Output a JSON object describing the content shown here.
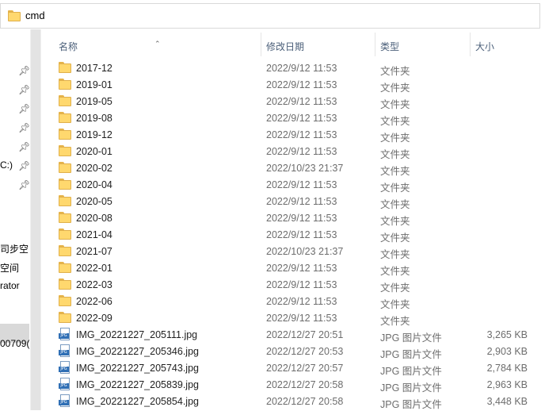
{
  "address": {
    "path": "cmd"
  },
  "nav": {
    "pins": [
      "pin-icon",
      "pin-icon",
      "pin-icon",
      "pin-icon",
      "pin-icon",
      "pin-icon",
      "pin-icon"
    ],
    "labels": [
      "C:)",
      "司步空",
      "空间",
      "rator",
      "00709("
    ]
  },
  "columns": {
    "name": "名称",
    "date": "修改日期",
    "type": "类型",
    "size": "大小"
  },
  "files": [
    {
      "name": "2017-12",
      "date": "2022/9/12 11:53",
      "type": "文件夹",
      "size": "",
      "icon": "folder-icon"
    },
    {
      "name": "2019-01",
      "date": "2022/9/12 11:53",
      "type": "文件夹",
      "size": "",
      "icon": "folder-icon"
    },
    {
      "name": "2019-05",
      "date": "2022/9/12 11:53",
      "type": "文件夹",
      "size": "",
      "icon": "folder-icon"
    },
    {
      "name": "2019-08",
      "date": "2022/9/12 11:53",
      "type": "文件夹",
      "size": "",
      "icon": "folder-icon"
    },
    {
      "name": "2019-12",
      "date": "2022/9/12 11:53",
      "type": "文件夹",
      "size": "",
      "icon": "folder-icon"
    },
    {
      "name": "2020-01",
      "date": "2022/9/12 11:53",
      "type": "文件夹",
      "size": "",
      "icon": "folder-icon"
    },
    {
      "name": "2020-02",
      "date": "2022/10/23 21:37",
      "type": "文件夹",
      "size": "",
      "icon": "folder-icon"
    },
    {
      "name": "2020-04",
      "date": "2022/9/12 11:53",
      "type": "文件夹",
      "size": "",
      "icon": "folder-icon"
    },
    {
      "name": "2020-05",
      "date": "2022/9/12 11:53",
      "type": "文件夹",
      "size": "",
      "icon": "folder-icon"
    },
    {
      "name": "2020-08",
      "date": "2022/9/12 11:53",
      "type": "文件夹",
      "size": "",
      "icon": "folder-icon"
    },
    {
      "name": "2021-04",
      "date": "2022/9/12 11:53",
      "type": "文件夹",
      "size": "",
      "icon": "folder-icon"
    },
    {
      "name": "2021-07",
      "date": "2022/10/23 21:37",
      "type": "文件夹",
      "size": "",
      "icon": "folder-icon"
    },
    {
      "name": "2022-01",
      "date": "2022/9/12 11:53",
      "type": "文件夹",
      "size": "",
      "icon": "folder-icon"
    },
    {
      "name": "2022-03",
      "date": "2022/9/12 11:53",
      "type": "文件夹",
      "size": "",
      "icon": "folder-icon"
    },
    {
      "name": "2022-06",
      "date": "2022/9/12 11:53",
      "type": "文件夹",
      "size": "",
      "icon": "folder-icon"
    },
    {
      "name": "2022-09",
      "date": "2022/9/12 11:53",
      "type": "文件夹",
      "size": "",
      "icon": "folder-icon"
    },
    {
      "name": "IMG_20221227_205111.jpg",
      "date": "2022/12/27 20:51",
      "type": "JPG 图片文件",
      "size": "3,265 KB",
      "icon": "jpg-file-icon"
    },
    {
      "name": "IMG_20221227_205346.jpg",
      "date": "2022/12/27 20:53",
      "type": "JPG 图片文件",
      "size": "2,903 KB",
      "icon": "jpg-file-icon"
    },
    {
      "name": "IMG_20221227_205743.jpg",
      "date": "2022/12/27 20:57",
      "type": "JPG 图片文件",
      "size": "2,784 KB",
      "icon": "jpg-file-icon"
    },
    {
      "name": "IMG_20221227_205839.jpg",
      "date": "2022/12/27 20:58",
      "type": "JPG 图片文件",
      "size": "2,963 KB",
      "icon": "jpg-file-icon"
    },
    {
      "name": "IMG_20221227_205854.jpg",
      "date": "2022/12/27 20:58",
      "type": "JPG 图片文件",
      "size": "3,448 KB",
      "icon": "jpg-file-icon"
    }
  ],
  "colors": {
    "header_text": "#4c607a",
    "detail_text": "#6d6d6d",
    "folder": "#ffd86e",
    "jpg_badge": "#2f6fb5"
  }
}
